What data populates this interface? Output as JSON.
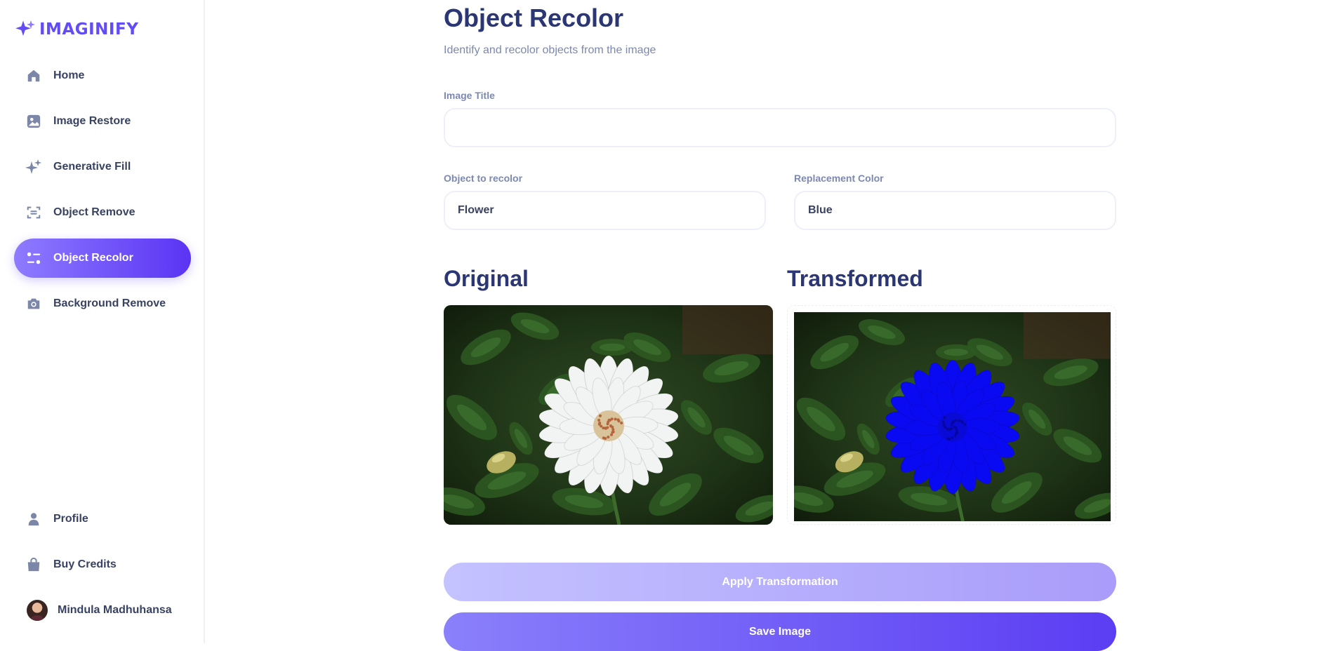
{
  "brand": {
    "name": "IMAGINIFY",
    "accent": "#624cf5"
  },
  "sidebar": {
    "items": [
      {
        "label": "Home",
        "icon": "home-icon",
        "active": false
      },
      {
        "label": "Image Restore",
        "icon": "image-icon",
        "active": false
      },
      {
        "label": "Generative Fill",
        "icon": "stars-icon",
        "active": false
      },
      {
        "label": "Object Remove",
        "icon": "scan-icon",
        "active": false
      },
      {
        "label": "Object Recolor",
        "icon": "filter-icon",
        "active": true
      },
      {
        "label": "Background Remove",
        "icon": "camera-icon",
        "active": false
      }
    ],
    "bottom": [
      {
        "label": "Profile",
        "icon": "user-icon"
      },
      {
        "label": "Buy Credits",
        "icon": "bag-icon"
      }
    ],
    "user": {
      "name": "Mindula Madhuhansa"
    }
  },
  "page": {
    "title": "Object Recolor",
    "subtitle": "Identify and recolor objects from the image"
  },
  "form": {
    "image_title": {
      "label": "Image Title",
      "value": "",
      "placeholder": ""
    },
    "object": {
      "label": "Object to recolor",
      "value": "Flower"
    },
    "color": {
      "label": "Replacement Color",
      "value": "Blue"
    }
  },
  "images": {
    "original_label": "Original",
    "transformed_label": "Transformed",
    "flower_original_color": "#f2f3f3",
    "flower_recolored_color": "#0a0af2"
  },
  "buttons": {
    "apply": "Apply Transformation",
    "save": "Save Image"
  }
}
